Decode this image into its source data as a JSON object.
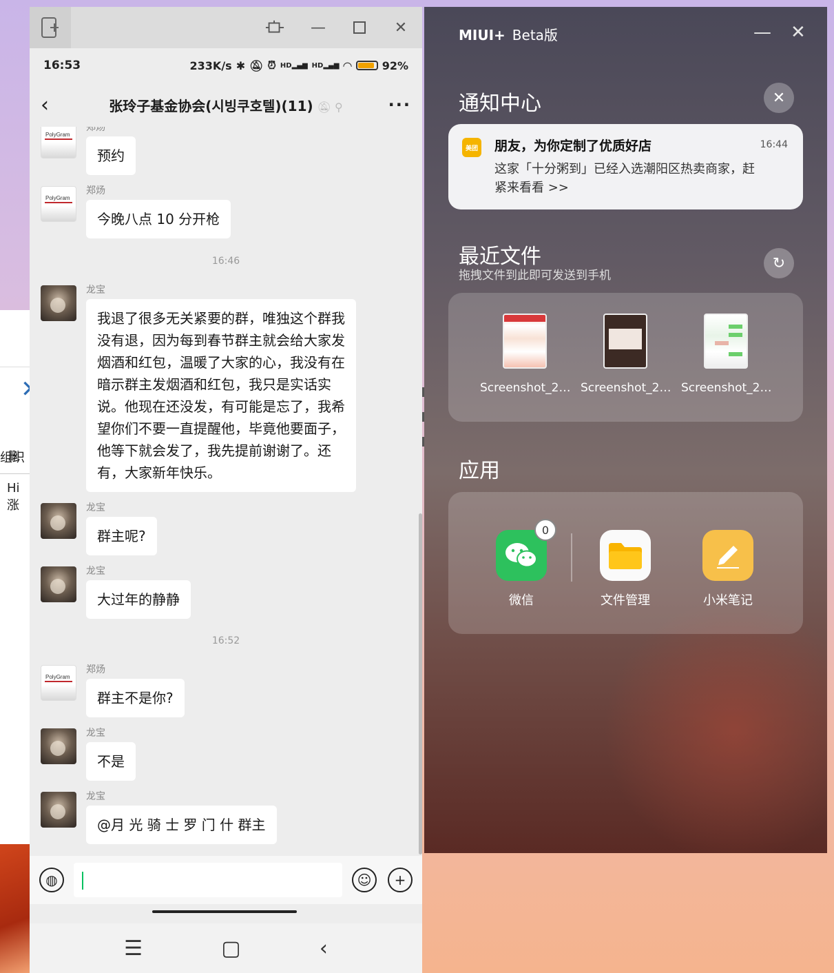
{
  "background_window": {
    "label_organize": "组织",
    "label_delete": "删",
    "label_hi": "Hi涨"
  },
  "phone": {
    "status": {
      "time": "16:53",
      "speed": "233K/s",
      "signal1": "HD",
      "signal2": "HD",
      "battery": "92%"
    },
    "chat": {
      "title": "张玲子基金协会(시빙쿠호텔)(11)",
      "messages": [
        {
          "sender": "郑炀",
          "avatar": "polygram",
          "avatar_text": "PolyGram",
          "text": "预约"
        },
        {
          "sender": "郑炀",
          "avatar": "polygram",
          "avatar_text": "PolyGram",
          "text": "今晚八点 10 分开枪"
        },
        {
          "timestamp": "16:46"
        },
        {
          "sender": "龙宝",
          "avatar": "dragon",
          "text": "我退了很多无关紧要的群，唯独这个群我没有退，因为每到春节群主就会给大家发烟酒和红包，温暖了大家的心，我没有在暗示群主发烟酒和红包，我只是实话实说。他现在还没发，有可能是忘了，我希望你们不要一直提醒他，毕竟他要面子，他等下就会发了，我先提前谢谢了。还有，大家新年快乐。"
        },
        {
          "sender": "龙宝",
          "avatar": "dragon",
          "text": "群主呢?"
        },
        {
          "sender": "龙宝",
          "avatar": "dragon",
          "text": "大过年的静静"
        },
        {
          "timestamp": "16:52"
        },
        {
          "sender": "郑炀",
          "avatar": "polygram",
          "avatar_text": "PolyGram",
          "text": "群主不是你?"
        },
        {
          "sender": "龙宝",
          "avatar": "dragon",
          "text": "不是"
        },
        {
          "sender": "龙宝",
          "avatar": "dragon",
          "text": "@月 光 骑 士 罗 门 什  群主"
        }
      ]
    }
  },
  "miui": {
    "title_brand": "MIUI+",
    "title_suffix": "Beta版",
    "notification_center": {
      "title": "通知中心",
      "items": [
        {
          "app_label": "美团",
          "title": "朋友，为你定制了优质好店",
          "time": "16:44",
          "body": "这家「十分粥到」已经入选潮阳区热卖商家，赶紧来看看 >>"
        }
      ]
    },
    "recent_files": {
      "title": "最近文件",
      "subtitle": "拖拽文件到此即可发送到手机",
      "files": [
        {
          "name": "Screenshot_2…"
        },
        {
          "name": "Screenshot_2…"
        },
        {
          "name": "Screenshot_2…"
        }
      ]
    },
    "apps": {
      "title": "应用",
      "items": [
        {
          "name": "微信",
          "badge": "0"
        },
        {
          "name": "文件管理"
        },
        {
          "name": "小米笔记"
        }
      ]
    }
  }
}
